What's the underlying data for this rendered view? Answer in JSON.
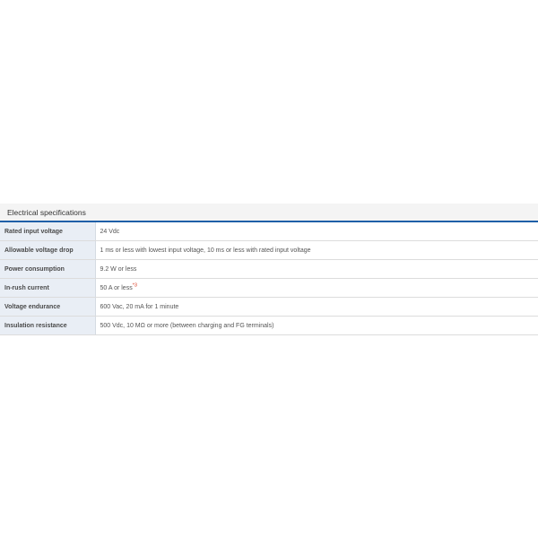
{
  "section": {
    "title": "Electrical specifications"
  },
  "rows": [
    {
      "label": "Rated input voltage",
      "value": "24 Vdc",
      "note": ""
    },
    {
      "label": "Allowable voltage drop",
      "value": "1 ms or less with lowest input voltage, 10 ms or less with rated input voltage",
      "note": ""
    },
    {
      "label": "Power consumption",
      "value": "9.2 W or less",
      "note": ""
    },
    {
      "label": "In-rush current",
      "value": "50 A or less",
      "note": "*3"
    },
    {
      "label": "Voltage endurance",
      "value": "600 Vac, 20 mA for 1 minute",
      "note": ""
    },
    {
      "label": "Insulation resistance",
      "value": "500 Vdc, 10 MΩ or more (between charging and FG terminals)",
      "note": ""
    }
  ],
  "colors": {
    "header_underline": "#1f5fa8",
    "label_background": "#e9eef5",
    "note_ref": "#d9381e"
  }
}
